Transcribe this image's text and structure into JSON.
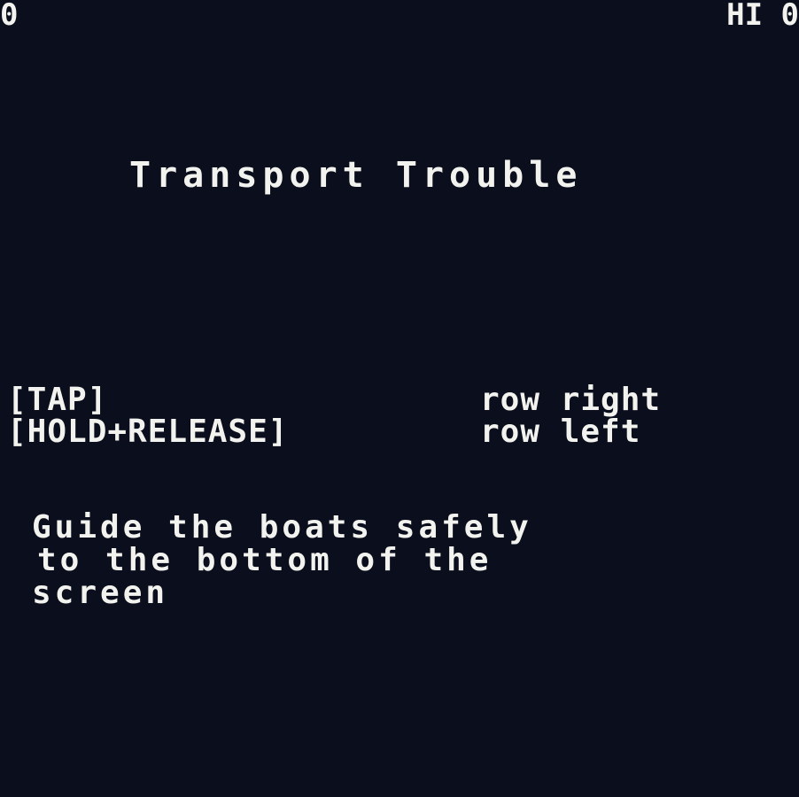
{
  "hud": {
    "score": "0",
    "hi_score": "HI 0"
  },
  "title": "Transport Trouble",
  "controls": [
    {
      "key": "[TAP]",
      "action": "row right"
    },
    {
      "key": "[HOLD+RELEASE]",
      "action": "row left"
    }
  ],
  "description": [
    "Guide the boats safely",
    "to the bottom of the",
    "screen"
  ],
  "colors": {
    "background": "#0b0e1c",
    "text": "#f2f2ee"
  }
}
